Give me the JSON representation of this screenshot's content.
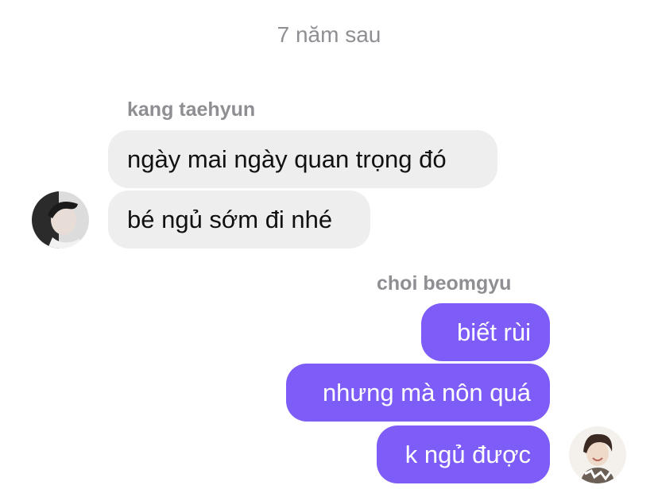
{
  "timestamp": "7 năm sau",
  "threads": [
    {
      "sender": "kang taehyun",
      "messages": [
        "ngày mai ngày quan trọng đó",
        "bé ngủ sớm đi nhé"
      ]
    },
    {
      "sender": "choi beomgyu",
      "messages": [
        "biết rùi",
        "nhưng mà nôn quá",
        "k ngủ được"
      ]
    }
  ],
  "colors": {
    "incoming_bubble": "#eeeeef",
    "outgoing_bubble": "#7e5cf7",
    "meta_text": "#8e8e93"
  }
}
